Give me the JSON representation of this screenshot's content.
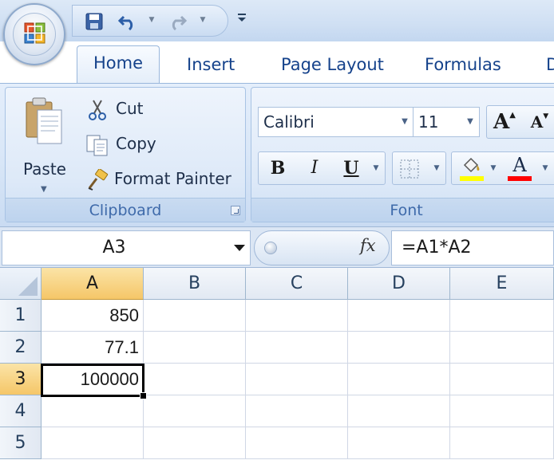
{
  "quick_access": {
    "save_icon": "save-icon",
    "undo_icon": "undo-icon",
    "redo_icon": "redo-icon",
    "customize_icon": "customize-qat-icon"
  },
  "tabs": [
    {
      "label": "Home",
      "active": true
    },
    {
      "label": "Insert"
    },
    {
      "label": "Page Layout"
    },
    {
      "label": "Formulas"
    },
    {
      "label": "D"
    }
  ],
  "clipboard": {
    "paste_label": "Paste",
    "cut_label": "Cut",
    "copy_label": "Copy",
    "format_painter_label": "Format Painter",
    "group_label": "Clipboard"
  },
  "font": {
    "family": "Calibri",
    "size": "11",
    "bold_label": "B",
    "italic_label": "I",
    "underline_label": "U",
    "grow_label": "A",
    "shrink_label": "A",
    "font_color_label": "A",
    "group_label": "Font",
    "highlight_color": "#ffff00",
    "font_color": "#ff0000"
  },
  "formula_bar": {
    "name_box": "A3",
    "fx_label": "fx",
    "formula": "=A1*A2"
  },
  "sheet": {
    "columns": [
      "A",
      "B",
      "C",
      "D",
      "E"
    ],
    "rows": [
      "1",
      "2",
      "3",
      "4",
      "5"
    ],
    "cells": {
      "A1": "850",
      "A2": "77.1",
      "A3": "100000"
    },
    "selected_cell": "A3"
  },
  "colors": {
    "ribbon": "#dbe7f7",
    "tab_text": "#15428b",
    "selection_header": "#f5c668",
    "gridline": "#d0d7e5"
  }
}
